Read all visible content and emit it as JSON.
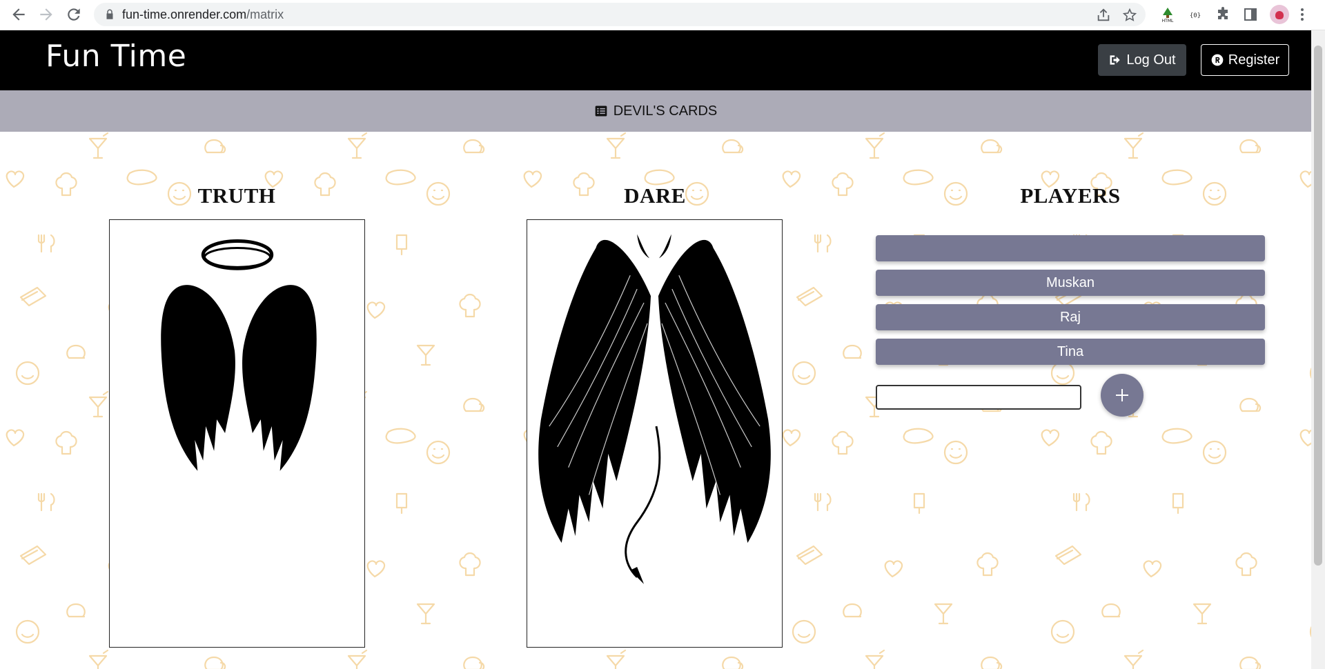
{
  "browser": {
    "url_host": "fun-time.onrender.com",
    "url_path": "/matrix"
  },
  "header": {
    "brand": "Fun Time",
    "logout_label": "Log Out",
    "register_label": "Register"
  },
  "subnav": {
    "label": "DEVIL'S CARDS"
  },
  "columns": {
    "truth_title": "TRUTH",
    "dare_title": "DARE",
    "players_title": "PLAYERS"
  },
  "players": [
    "",
    "Muskan",
    "Raj",
    "Tina"
  ],
  "new_player": {
    "value": "",
    "placeholder": ""
  },
  "colors": {
    "header_bg": "#000000",
    "subnav_bg": "#acabb7",
    "player_bg": "#777893",
    "pattern": "#f5d9a8"
  }
}
